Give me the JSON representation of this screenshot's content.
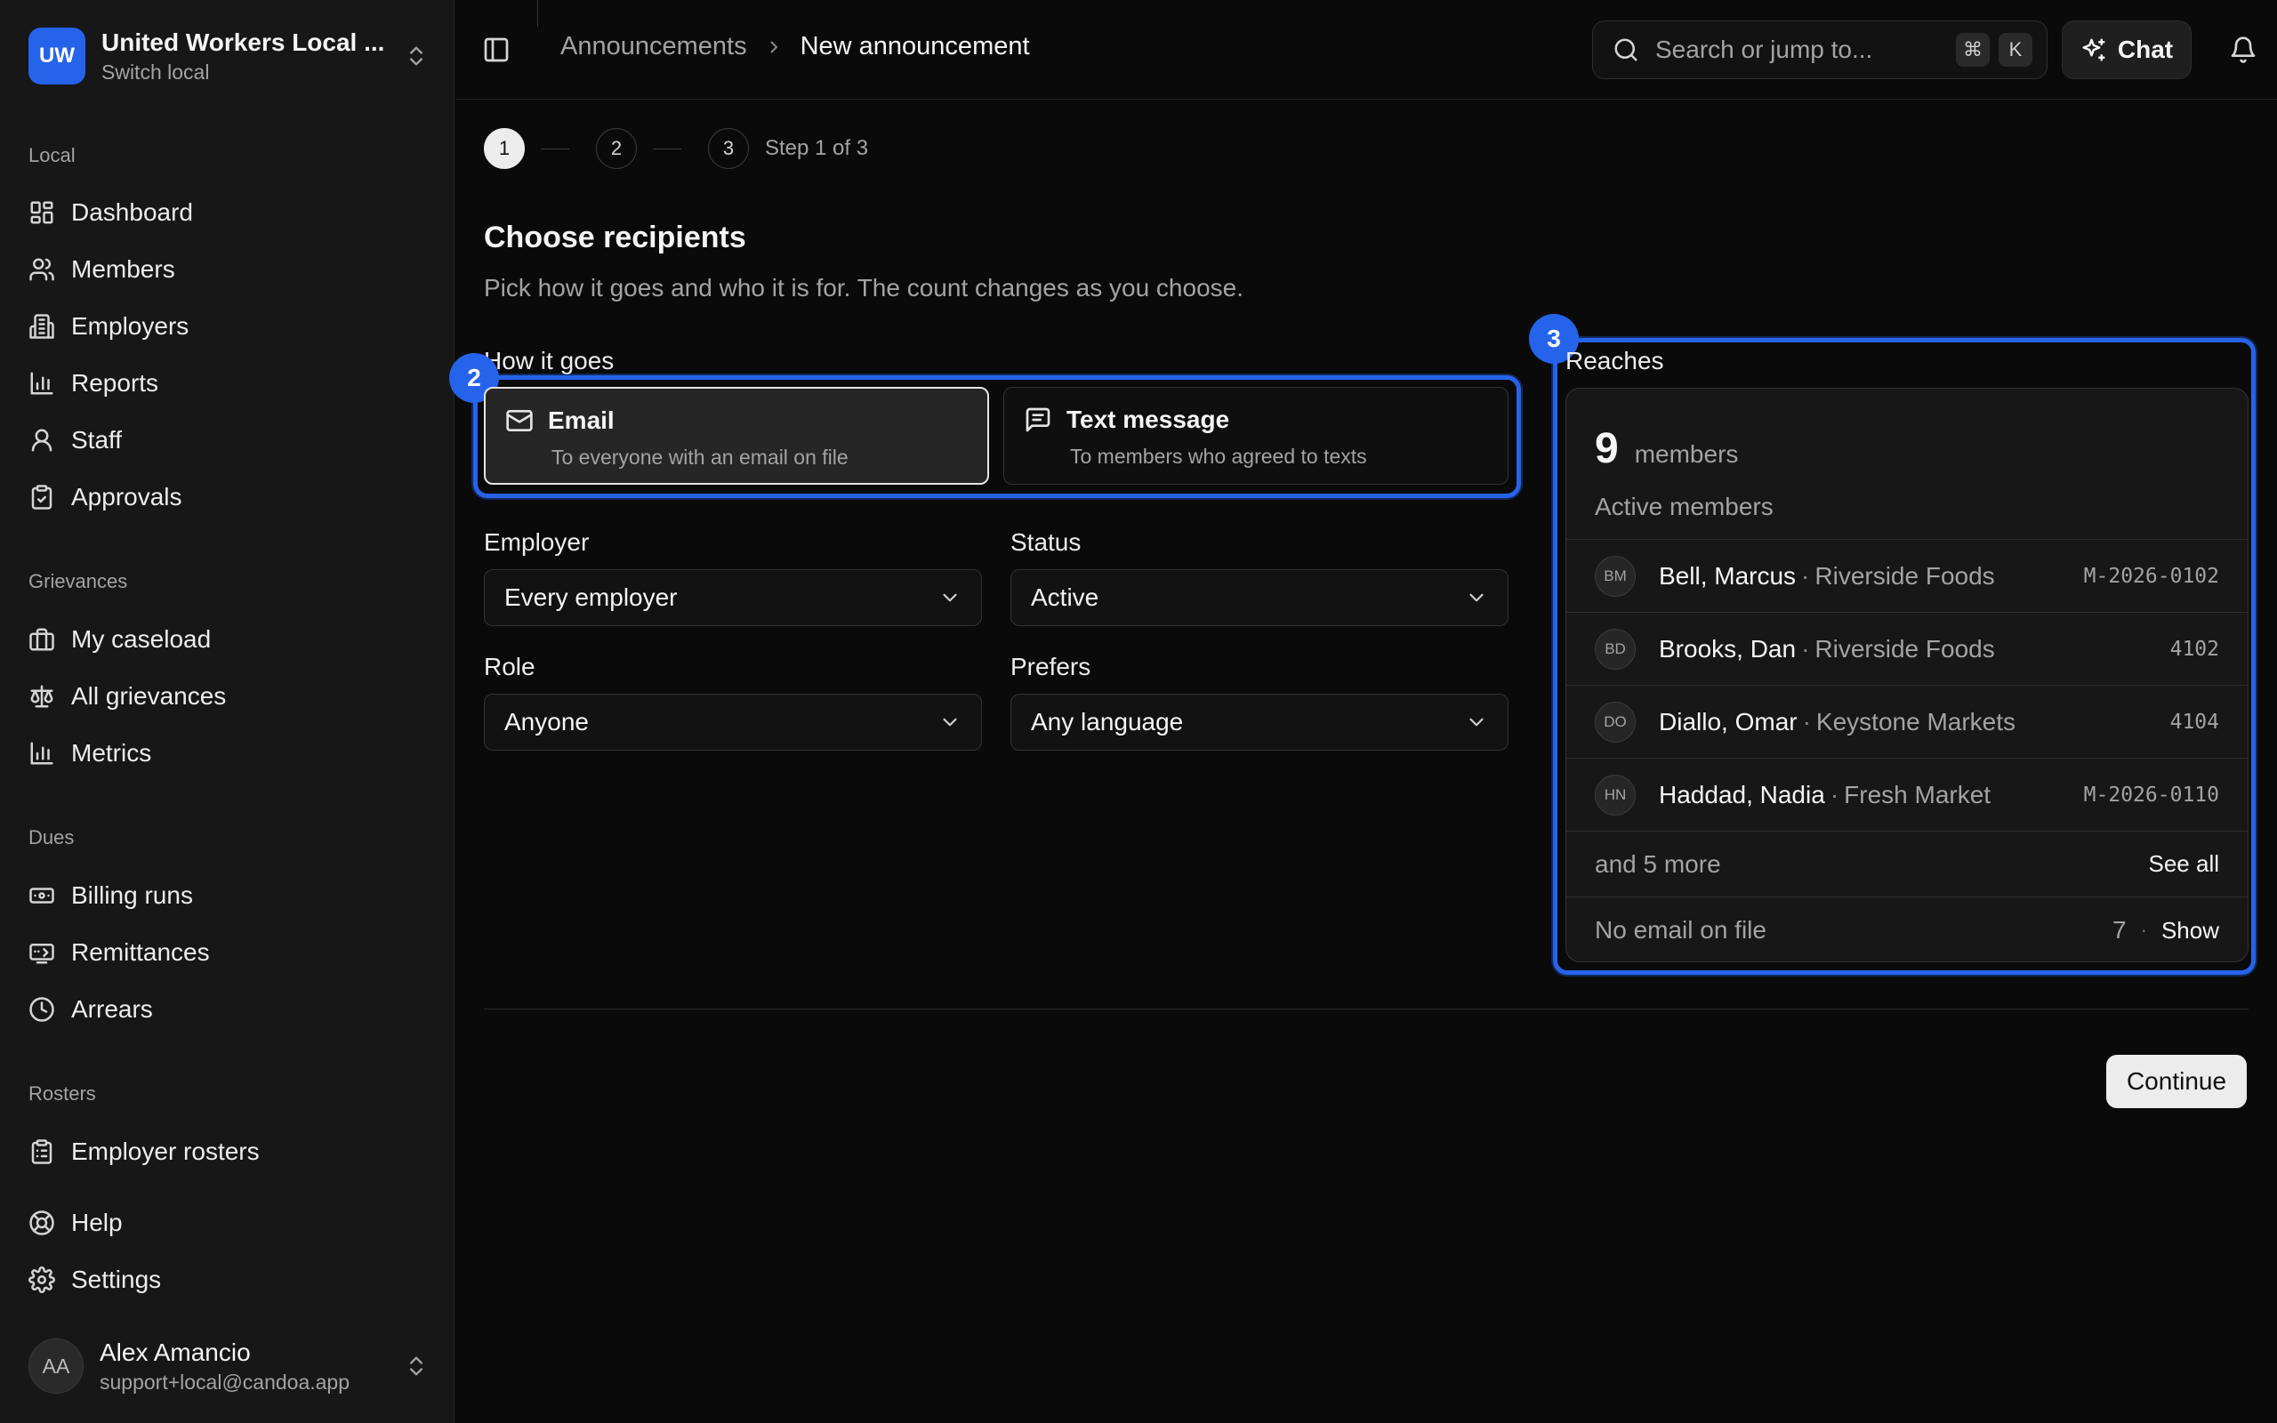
{
  "org": {
    "initials": "UW",
    "name": "United Workers Local ...",
    "sub": "Switch local"
  },
  "sidebar": {
    "sections": [
      "Local",
      "Grievances",
      "Dues",
      "Rosters"
    ],
    "local": [
      {
        "label": "Dashboard",
        "icon": "dashboard-icon"
      },
      {
        "label": "Members",
        "icon": "users-icon"
      },
      {
        "label": "Employers",
        "icon": "building-icon"
      },
      {
        "label": "Reports",
        "icon": "bar-chart-icon"
      },
      {
        "label": "Staff",
        "icon": "user-icon"
      },
      {
        "label": "Approvals",
        "icon": "clipboard-check-icon"
      }
    ],
    "grievances": [
      {
        "label": "My caseload",
        "icon": "briefcase-icon"
      },
      {
        "label": "All grievances",
        "icon": "scale-icon"
      },
      {
        "label": "Metrics",
        "icon": "bar-chart-icon"
      }
    ],
    "dues": [
      {
        "label": "Billing runs",
        "icon": "banknote-icon"
      },
      {
        "label": "Remittances",
        "icon": "receipt-icon"
      },
      {
        "label": "Arrears",
        "icon": "clock-icon"
      }
    ],
    "rosters": [
      {
        "label": "Employer rosters",
        "icon": "clipboard-list-icon"
      }
    ],
    "footer": [
      {
        "label": "Help",
        "icon": "lifebuoy-icon"
      },
      {
        "label": "Settings",
        "icon": "gear-icon"
      }
    ]
  },
  "user": {
    "initials": "AA",
    "name": "Alex Amancio",
    "email": "support+local@candoa.app"
  },
  "topbar": {
    "breadcrumb": [
      "Announcements",
      "New announcement"
    ],
    "search_placeholder": "Search or jump to...",
    "search_keys": [
      "⌘",
      "K"
    ],
    "chat_label": "Chat"
  },
  "stepper": {
    "steps": [
      "1",
      "2",
      "3"
    ],
    "current": 1,
    "label": "Step 1 of 3"
  },
  "main": {
    "title": "Choose recipients",
    "description": "Pick how it goes and who it is for. The count changes as you choose.",
    "how_label": "How it goes",
    "channels": [
      {
        "title": "Email",
        "sub": "To everyone with an email on file",
        "selected": true
      },
      {
        "title": "Text message",
        "sub": "To members who agreed to texts",
        "selected": false
      }
    ],
    "filters": {
      "employer": {
        "label": "Employer",
        "value": "Every employer"
      },
      "status": {
        "label": "Status",
        "value": "Active"
      },
      "role": {
        "label": "Role",
        "value": "Anyone"
      },
      "prefers": {
        "label": "Prefers",
        "value": "Any language"
      }
    },
    "continue_label": "Continue"
  },
  "annotations": {
    "channel_badge": "2",
    "reaches_badge": "3",
    "accent": "#2563eb"
  },
  "reaches": {
    "label": "Reaches",
    "count": "9",
    "unit": "members",
    "filter_desc": "Active members",
    "members": [
      {
        "initials": "BM",
        "name": "Bell, Marcus",
        "employer": "Riverside Foods",
        "id": "M-2026-0102"
      },
      {
        "initials": "BD",
        "name": "Brooks, Dan",
        "employer": "Riverside Foods",
        "id": "4102"
      },
      {
        "initials": "DO",
        "name": "Diallo, Omar",
        "employer": "Keystone Markets",
        "id": "4104"
      },
      {
        "initials": "HN",
        "name": "Haddad, Nadia",
        "employer": "Fresh Market",
        "id": "M-2026-0110"
      }
    ],
    "more_text": "and 5 more",
    "see_all": "See all",
    "no_email_label": "No email on file",
    "no_email_count": "7",
    "no_email_sep": "·",
    "show_label": "Show"
  }
}
